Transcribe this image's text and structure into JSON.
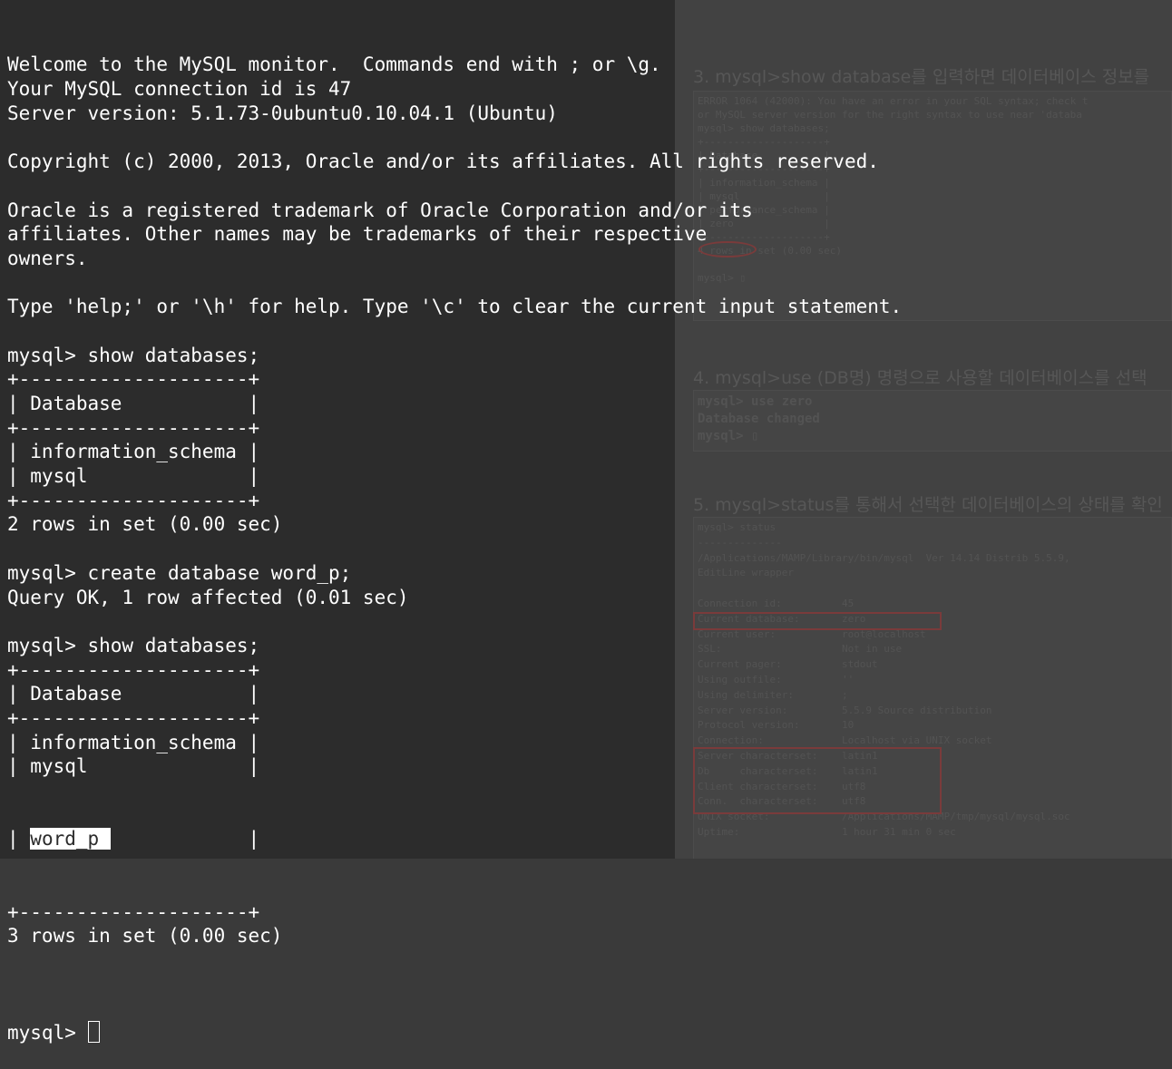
{
  "terminal": {
    "lines": [
      "Welcome to the MySQL monitor.  Commands end with ; or \\g.",
      "Your MySQL connection id is 47",
      "Server version: 5.1.73-0ubuntu0.10.04.1 (Ubuntu)",
      "",
      "Copyright (c) 2000, 2013, Oracle and/or its affiliates. All rights reserved.",
      "",
      "Oracle is a registered trademark of Oracle Corporation and/or its",
      "affiliates. Other names may be trademarks of their respective",
      "owners.",
      "",
      "Type 'help;' or '\\h' for help. Type '\\c' to clear the current input statement.",
      "",
      "mysql> show databases;",
      "+--------------------+",
      "| Database           |",
      "+--------------------+",
      "| information_schema |",
      "| mysql              |",
      "+--------------------+",
      "2 rows in set (0.00 sec)",
      "",
      "mysql> create database word_p;",
      "Query OK, 1 row affected (0.01 sec)",
      "",
      "mysql> show databases;",
      "+--------------------+",
      "| Database           |",
      "+--------------------+",
      "| information_schema |",
      "| mysql              |"
    ],
    "selected_row_prefix": "| ",
    "selected_row_text": "word_p ",
    "selected_row_suffix": "            |",
    "after_lines": [
      "+--------------------+",
      "3 rows in set (0.00 sec)",
      ""
    ],
    "prompt": "mysql> "
  },
  "background": {
    "heading_top": "3. mysql>show database를 입력하면 데이터베이스 정보를",
    "box1": "ERROR 1064 (42000): You have an error in your SQL syntax; check t\nor MySQL server version for the right syntax to use near 'databa\nmysql> show databases;\n+--------------------+\n| Database           |\n+--------------------+\n| information_schema |\n| mysql              |\n| performance_schema |\n| zero               |\n+--------------------+\n4 rows in set (0.00 sec)\n\nmysql> ▯",
    "heading_4": "4. mysql>use (DB명) 명령으로 사용할 데이터베이스를 선택",
    "box2": "mysql> use zero\nDatabase changed\nmysql> ▯",
    "heading_5": "5. mysql>status를 통해서 선택한 데이터베이스의 상태를 확인",
    "box3": "mysql> status\n--------------\n/Applications/MAMP/Library/bin/mysql  Ver 14.14 Distrib 5.5.9,\nEditLine wrapper\n\nConnection id:          45\nCurrent database:       zero\nCurrent user:           root@localhost\nSSL:                    Not in use\nCurrent pager:          stdout\nUsing outfile:          ''\nUsing delimiter:        ;\nServer version:         5.5.9 Source distribution\nProtocol version:       10\nConnection:             Localhost via UNIX socket\nServer characterset:    latin1\nDb     characterset:    latin1\nClient characterset:    utf8\nConn.  characterset:    utf8\nUNIX socket:            /Applications/MAMP/tmp/mysql/mysql.soc\nUptime:                 1 hour 31 min 0 sec"
  }
}
